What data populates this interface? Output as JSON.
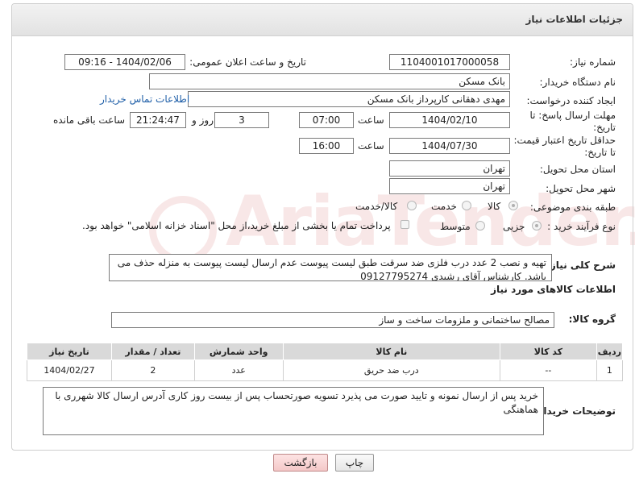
{
  "header": {
    "title": "جزئیات اطلاعات نیاز"
  },
  "fields": {
    "need_number_label": "شماره نیاز:",
    "need_number": "1104001017000058",
    "announce_label": "تاریخ و ساعت اعلان عمومی:",
    "announce_value": "1404/02/06 - 09:16",
    "buyer_org_label": "نام دستگاه خریدار:",
    "buyer_org": "بانک مسکن",
    "creator_label": "ایجاد کننده درخواست:",
    "creator": "مهدی دهقانی کارپرداز بانک مسکن",
    "contact_link": "اطلاعات تماس خریدار",
    "deadline_label_1": "مهلت ارسال پاسخ: تا",
    "deadline_label_2": "تاریخ:",
    "deadline_date": "1404/02/10",
    "time_label": "ساعت",
    "deadline_time": "07:00",
    "days_value": "3",
    "days_label": "روز و",
    "remaining_time": "21:24:47",
    "remaining_label": "ساعت باقی مانده",
    "validity_label_1": "حداقل تاریخ اعتبار قیمت:",
    "validity_label_2": "تا تاریخ:",
    "validity_date": "1404/07/30",
    "validity_time": "16:00",
    "province_label": "استان محل تحویل:",
    "province": "تهران",
    "city_label": "شهر محل تحویل:",
    "city": "تهران",
    "category_label": "طبقه بندی موضوعی:",
    "category_options": [
      "کالا",
      "خدمت",
      "کالا/خدمت"
    ],
    "purchase_type_label": "نوع فرآیند خرید :",
    "purchase_options": [
      "جزیی",
      "متوسط"
    ],
    "payment_note": "پرداخت تمام یا بخشی از مبلغ خرید،از محل \"اسناد خزانه اسلامی\" خواهد بود.",
    "description_label": "شرح کلی نیاز:",
    "description": "تهیه و نصب  2 عدد درب فلزی ضد سرقت طبق لیست پیوست عدم ارسال لیست پیوست به منزله حذف می باشد. کارشناس  آقای رشیدی 09127795274"
  },
  "goods": {
    "section_title": "اطلاعات کالاهای مورد نیاز",
    "group_label": "گروه کالا:",
    "group_value": "مصالح ساختمانی و ملزومات ساخت و ساز",
    "columns": [
      "ردیف",
      "کد کالا",
      "نام کالا",
      "واحد شمارش",
      "تعداد / مقدار",
      "تاریخ نیاز"
    ],
    "rows": [
      [
        "1",
        "--",
        "درب ضد حریق",
        "عدد",
        "2",
        "1404/02/27"
      ]
    ]
  },
  "buyer_notes": {
    "label": "توضیحات خریدار:",
    "text": "خرید پس از ارسال نمونه و تایید صورت می پذیرد تسویه صورتحساب پس از بیست روز کاری آدرس ارسال کالا شهرری با هماهنگی"
  },
  "buttons": {
    "print": "چاپ",
    "back": "بازگشت"
  },
  "watermark": "AriaTender.neT",
  "colors": {
    "link": "#1f5fa8",
    "header_bg": "#e6e6e6",
    "back_button": "#f4c8c8"
  }
}
